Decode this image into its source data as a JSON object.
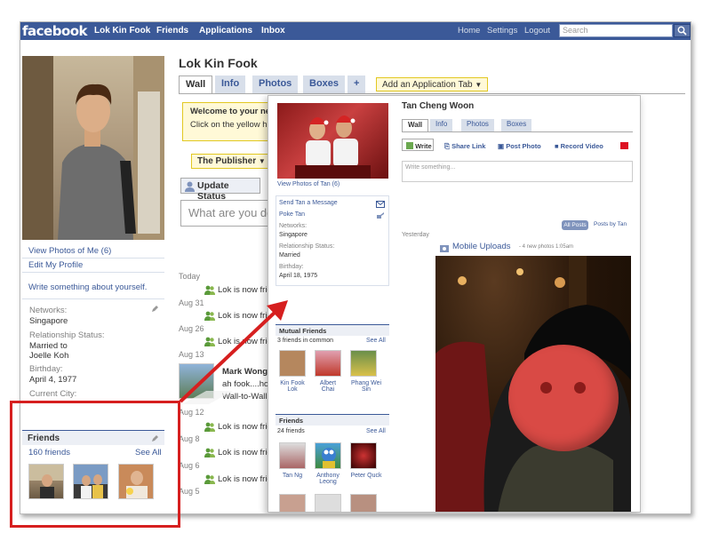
{
  "topbar": {
    "logo": "facebook",
    "nav": [
      "Lok Kin Fook",
      "Friends",
      "Applications",
      "Inbox"
    ],
    "links": [
      "Home",
      "Settings",
      "Logout"
    ],
    "search_placeholder": "Search"
  },
  "left": {
    "view_photos": "View Photos of Me (6)",
    "edit_profile": "Edit My Profile",
    "write_about": "Write something about yourself.",
    "info": {
      "networks_label": "Networks:",
      "networks": "Singapore",
      "relationship_label": "Relationship Status:",
      "relationship_1": "Married to",
      "relationship_2": "Joelle Koh",
      "birthday_label": "Birthday:",
      "birthday": "April 4, 1977",
      "city_label": "Current City:"
    },
    "friends": {
      "title": "Friends",
      "count": "160 friends",
      "see_all": "See All"
    }
  },
  "main": {
    "name": "Lok Kin Fook",
    "tabs": [
      "Wall",
      "Info",
      "Photos",
      "Boxes",
      "+"
    ],
    "add_tab": "Add an Application Tab",
    "welcome_title": "Welcome to your ne",
    "welcome_text": "Click on the yellow high",
    "publisher": "The Publisher",
    "update_status": "Update Status",
    "status_placeholder": "What are you do",
    "feed": [
      {
        "day": "Today",
        "text": "Lok is now frien"
      },
      {
        "day": "Aug 31",
        "text": "Lok is now frien"
      },
      {
        "day": "Aug 26",
        "text": "Lok is now frien"
      },
      {
        "day": "Aug 13",
        "text": ""
      },
      {
        "day": "Aug 12",
        "text": "Lok is now frien"
      },
      {
        "day": "Aug 8",
        "text": "Lok is now frien"
      },
      {
        "day": "Aug 6",
        "text": "Lok is now frien"
      },
      {
        "day": "Aug 5",
        "text": ""
      }
    ],
    "wall_post": {
      "author": "Mark Wong",
      "text": "ah fook....hor",
      "link": "Wall-to-Wall -"
    }
  },
  "overlay": {
    "name": "Tan Cheng Woon",
    "tabs": [
      "Wall",
      "Info",
      "Photos",
      "Boxes"
    ],
    "view_photos": "View Photos of Tan (6)",
    "send_message": "Send Tan a Message",
    "poke": "Poke Tan",
    "networks_label": "Networks:",
    "networks": "Singapore",
    "relationship_label": "Relationship Status:",
    "relationship": "Married",
    "birthday_label": "Birthday:",
    "birthday": "April 18, 1975",
    "mutual_title": "Mutual Friends",
    "mutual_count": "3 friends in common",
    "see_all": "See All",
    "mutual_names": [
      "Kin Fook Lok",
      "Albert Chai",
      "Phang Wei Sin"
    ],
    "friends_title": "Friends",
    "friends_count": "24 friends",
    "friend_names": [
      "Tan Ng",
      "Anthony Leong",
      "Peter Quck"
    ],
    "actions": [
      "Write",
      "Share Link",
      "Post Photo",
      "Record Video"
    ],
    "write_placeholder": "Write something...",
    "filter_all": "All Posts",
    "filter_tan": "Posts by Tan",
    "yesterday": "Yesterday",
    "mobile_uploads": "Mobile Uploads",
    "mobile_meta": "- 4 new photos 1:05am"
  },
  "colors": {
    "brand": "#3b5998",
    "highlight_box": "#d61f1f",
    "face_blur": "#d94a45"
  }
}
